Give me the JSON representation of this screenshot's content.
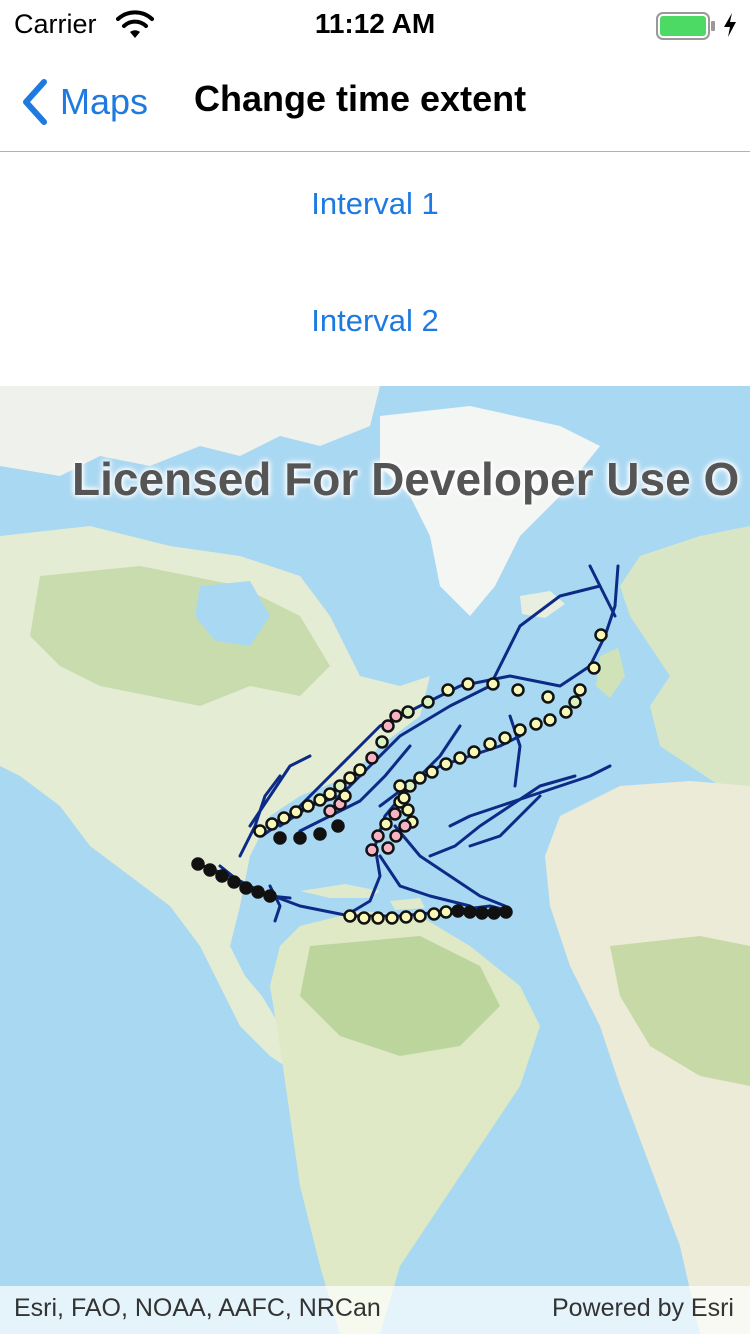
{
  "status_bar": {
    "carrier": "Carrier",
    "time": "11:12 AM",
    "battery_color": "#4cd964"
  },
  "nav": {
    "back_label": "Maps",
    "title": "Change time extent"
  },
  "buttons": {
    "interval_1": "Interval 1",
    "interval_2": "Interval 2"
  },
  "map": {
    "basemap": "ocean-imagery",
    "watermark": "Licensed For Developer Use O",
    "track_color": "#0d2b86",
    "point_colors": [
      "#f7f7b8",
      "#d9f2c0",
      "#f7b3c4",
      "#111111"
    ],
    "attribution": "Esri, FAO, NOAA, AAFC, NRCan",
    "powered_by": "Powered by Esri"
  }
}
